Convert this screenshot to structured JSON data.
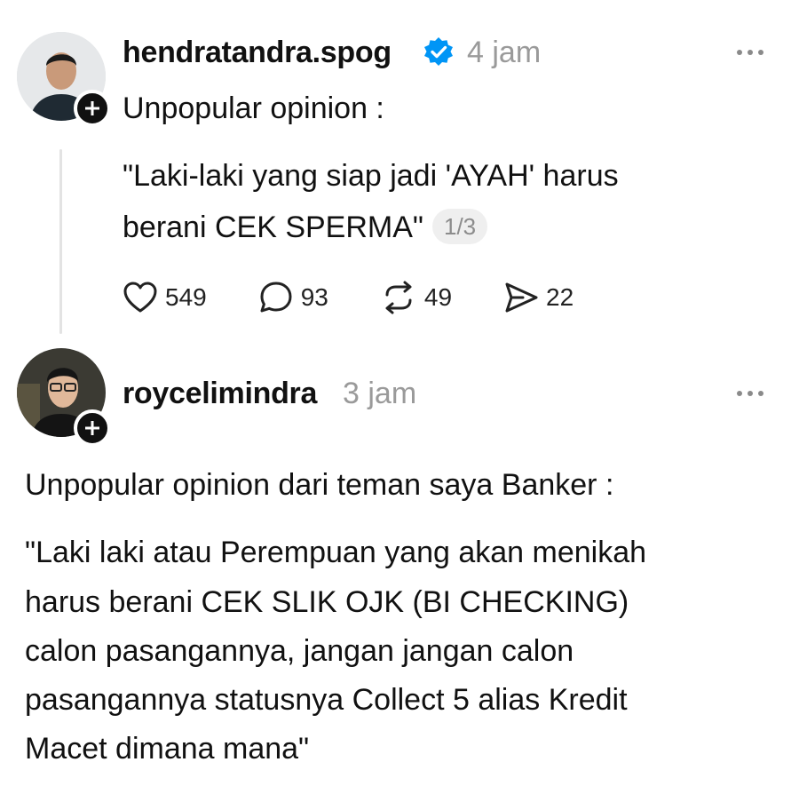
{
  "post1": {
    "username": "hendratandra.spog",
    "time": "4 jam",
    "verified": true,
    "lines": [
      "Unpopular opinion :",
      "\"Laki-laki yang siap jadi 'AYAH' harus",
      "berani CEK SPERMA\""
    ],
    "page_indicator": "1/3",
    "stats": {
      "likes": "549",
      "replies": "93",
      "reposts": "49",
      "shares": "22"
    }
  },
  "post2": {
    "username": "roycelimindra",
    "time": "3 jam",
    "lines": [
      "Unpopular opinion dari teman saya Banker :",
      "\"Laki laki atau Perempuan yang akan menikah",
      "harus berani CEK SLIK OJK (BI CHECKING)",
      "calon pasangannya, jangan jangan calon",
      "pasangannya statusnya Collect 5 alias Kredit",
      "Macet dimana mana\""
    ]
  },
  "colors": {
    "verified_badge": "#0095f6",
    "muted_text": "#9a9a9a",
    "thread_line": "#e3e3e3"
  }
}
